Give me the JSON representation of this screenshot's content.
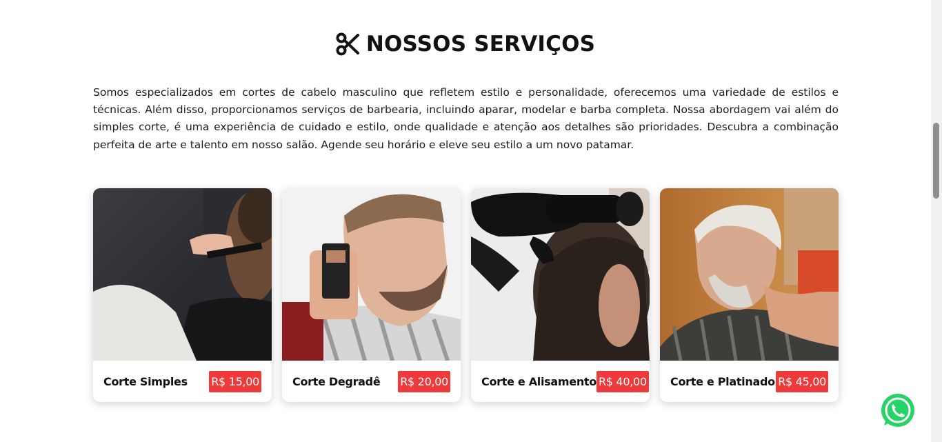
{
  "services": {
    "title": "NOSSOS SERVIÇOS",
    "title_icon": "scissors-icon",
    "description": "Somos especializados em cortes de cabelo masculino que refletem estilo e personalidade, oferecemos uma variedade de estilos e técnicas. Além disso, proporcionamos serviços de barbearia, incluindo aparar, modelar e barba completa. Nossa abordagem vai além do simples corte, é uma experiência de cuidado e estilo, onde qualidade e atenção aos detalhes são prioridades. Descubra a combinação perfeita de arte e talento em nosso salão. Agende seu horário e eleve seu estilo a um novo patamar.",
    "cards": [
      {
        "name": "Corte Simples",
        "price": "R$ 15,00"
      },
      {
        "name": "Corte Degradê",
        "price": "R$ 20,00"
      },
      {
        "name": "Corte e Alisamento",
        "price": "R$ 40,00"
      },
      {
        "name": "Corte e Platinado",
        "price": "R$ 45,00"
      }
    ]
  },
  "colors": {
    "price_badge": "#ee3a3a",
    "whatsapp": "#25d366"
  },
  "floating": {
    "whatsapp_icon": "whatsapp-icon"
  }
}
